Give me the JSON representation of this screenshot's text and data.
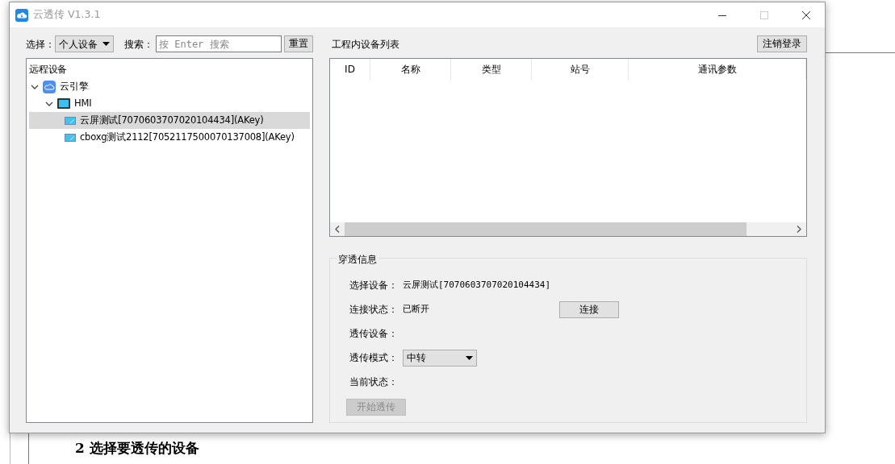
{
  "window": {
    "title": "云透传 V1.3.1"
  },
  "filter": {
    "select_label": "选择：",
    "select_value": "个人设备",
    "search_label": "搜索：",
    "search_placeholder": "按 Enter 搜索",
    "reset_button": "重置"
  },
  "tree": {
    "header": "远程设备",
    "items": [
      {
        "label": "云引擎",
        "kind": "cloud",
        "expanded": true,
        "selected": false,
        "children": [
          {
            "label": "HMI",
            "kind": "hmi",
            "expanded": true,
            "selected": false,
            "children": [
              {
                "label": "云屏测试[7070603707020104434](AKey)",
                "kind": "device",
                "selected": true
              },
              {
                "label": "cboxg测试2112[7052117500070137008](AKey)",
                "kind": "device",
                "selected": false
              }
            ]
          }
        ]
      }
    ]
  },
  "device_list": {
    "title": "工程内设备列表",
    "logout_button": "注销登录",
    "columns": [
      "ID",
      "名称",
      "类型",
      "站号",
      "通讯参数"
    ]
  },
  "passthrough": {
    "title": "穿透信息",
    "fields": [
      {
        "label": "选择设备：",
        "kind": "text",
        "value": "云屏测试[7070603707020104434]"
      },
      {
        "label": "连接状态：",
        "kind": "text",
        "value": "已断开",
        "button": "连接"
      },
      {
        "label": "透传设备：",
        "kind": "text"
      },
      {
        "label": "透传模式：",
        "kind": "select",
        "value": "中转"
      },
      {
        "label": "当前状态：",
        "kind": "text"
      }
    ],
    "start_button": {
      "label": "开始透传",
      "disabled": true
    }
  },
  "background_doc": {
    "heading": "2 选择要透传的设备"
  }
}
